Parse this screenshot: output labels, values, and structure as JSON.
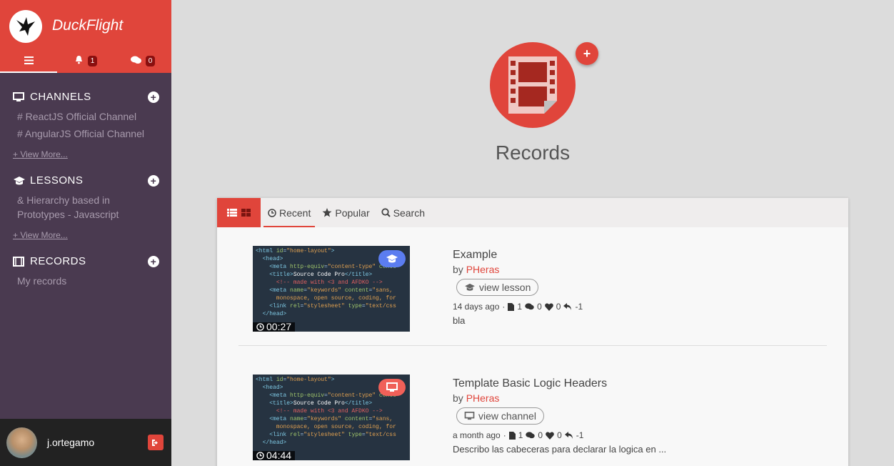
{
  "brand": {
    "name": "DuckFlight"
  },
  "nav_tabs": [
    {
      "icon": "menu-icon"
    },
    {
      "icon": "bell-icon",
      "count": "1"
    },
    {
      "icon": "comments-icon",
      "count": "0"
    }
  ],
  "sidebar": {
    "channels": {
      "title": "CHANNELS",
      "items": [
        "# ReactJS Official Channel",
        "# AngularJS Official Channel"
      ],
      "view_more": "+ View More..."
    },
    "lessons": {
      "title": "LESSONS",
      "items": [
        "& Hierarchy based in Prototypes - Javascript"
      ],
      "view_more": "+ View More..."
    },
    "records": {
      "title": "RECORDS",
      "items": [
        "My records"
      ]
    }
  },
  "user": {
    "name": "j.ortegamo"
  },
  "hero": {
    "title": "Records"
  },
  "panel_tabs": [
    {
      "label": "Recent",
      "icon": "clock-icon",
      "active": true
    },
    {
      "label": "Popular",
      "icon": "star-icon",
      "active": false
    },
    {
      "label": "Search",
      "icon": "search-icon",
      "active": false
    }
  ],
  "records": [
    {
      "title": "Example",
      "by": "by",
      "author": "PHeras",
      "duration": "00:27",
      "type_icon": "graduation-cap-icon",
      "type_color": "#5b7df0",
      "button": "view lesson",
      "time": "14 days ago",
      "files": "1",
      "comments": "0",
      "likes": "0",
      "replies": "-1",
      "description": "bla"
    },
    {
      "title": "Template Basic Logic Headers",
      "by": "by",
      "author": "PHeras",
      "duration": "04:44",
      "type_icon": "monitor-icon",
      "type_color": "#f06058",
      "button": "view channel",
      "time": "a month ago",
      "files": "1",
      "comments": "0",
      "likes": "0",
      "replies": "-1",
      "description": "Describo las cabeceras para declarar la logica en ..."
    }
  ],
  "colors": {
    "accent": "#e0453b",
    "sidebar": "#4a3a50"
  }
}
